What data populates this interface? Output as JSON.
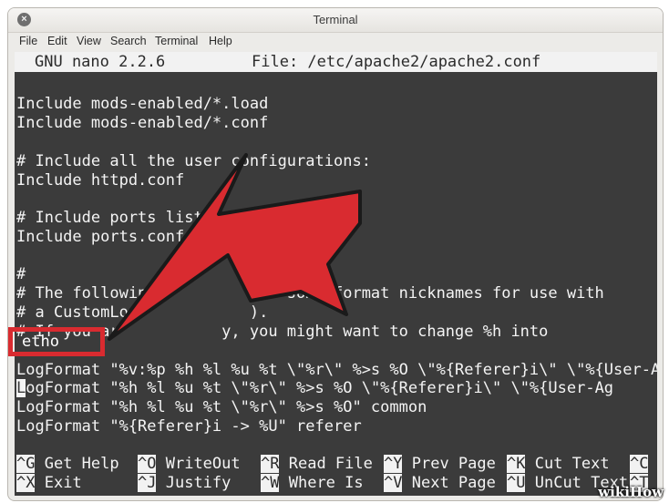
{
  "window": {
    "title": "Terminal"
  },
  "menu": [
    "File",
    "Edit",
    "View",
    "Search",
    "Terminal",
    "Help"
  ],
  "nano": {
    "version": "GNU nano 2.2.6",
    "file": "File: /etc/apache2/apache2.conf"
  },
  "lines": [
    "Include mods-enabled/*.load",
    "Include mods-enabled/*.conf",
    "",
    "# Include all the user configurations:",
    "Include httpd.conf",
    "",
    "# Include ports listi",
    "Include ports.conf",
    "",
    "#",
    "# The followin           ine some format nicknames for use with",
    "# a CustomLog            ).",
    "# If you ar           y, you might want to change %h into",
    "",
    "LogFormat \"%v:%p %h %l %u %t \\\"%r\\\" %>s %O \\\"%{Referer}i\\\" \\\"%{User-A",
    "ogFormat \"%h %l %u %t \\\"%r\\\" %>s %O \\\"%{Referer}i\\\" \\\"%{User-Ag",
    "LogFormat \"%h %l %u %t \\\"%r\\\" %>s %O\" common",
    "LogFormat \"%{Referer}i -> %U\" referer"
  ],
  "cursor_char": "L",
  "highlight_text": "etho",
  "shortcuts": {
    "row1": [
      {
        "key": "^G",
        "label": "Get Help"
      },
      {
        "key": "^O",
        "label": "WriteOut"
      },
      {
        "key": "^R",
        "label": "Read File"
      },
      {
        "key": "^Y",
        "label": "Prev Page"
      },
      {
        "key": "^K",
        "label": "Cut Text"
      },
      {
        "key": "^C",
        "label": ""
      }
    ],
    "row2": [
      {
        "key": "^X",
        "label": "Exit"
      },
      {
        "key": "^J",
        "label": "Justify"
      },
      {
        "key": "^W",
        "label": "Where Is"
      },
      {
        "key": "^V",
        "label": "Next Page"
      },
      {
        "key": "^U",
        "label": "UnCut Text"
      },
      {
        "key": "^T",
        "label": ""
      }
    ]
  },
  "watermark": "wikiHow",
  "colors": {
    "arrow": "#d92b30",
    "terminal_bg": "#3b3b3b",
    "terminal_fg": "#f4f4f4"
  }
}
